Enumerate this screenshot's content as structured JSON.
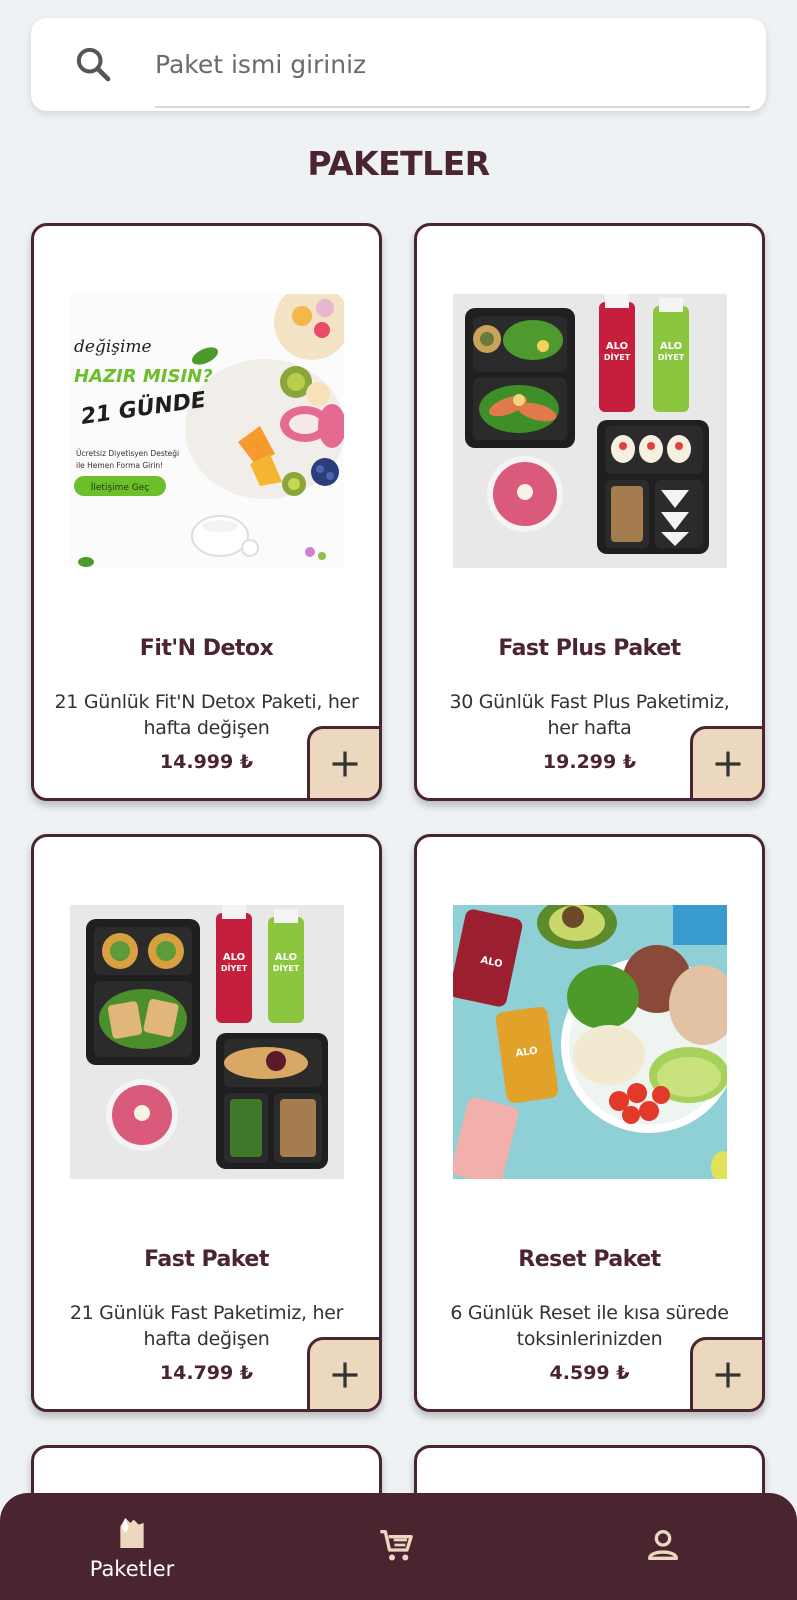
{
  "search": {
    "placeholder": "Paket ismi giriniz",
    "value": ""
  },
  "page_title": "PAKETLER",
  "cards": [
    {
      "name": "Fit'N Detox",
      "desc": "21 Günlük Fit'N Detox Paketi, her hafta değişen",
      "price": "14.999 ₺",
      "promo": {
        "line1": "değişime",
        "line2": "HAZIR MISIN?",
        "line3": "21 GÜNDE",
        "line4": "Ücretsiz Diyetisyen Desteği",
        "line5": "ile Hemen Forma Girin!",
        "cta": "İletişime Geç"
      }
    },
    {
      "name": "Fast Plus Paket",
      "desc": "30 Günlük Fast Plus Paketimiz, her hafta",
      "price": "19.299 ₺"
    },
    {
      "name": "Fast Paket",
      "desc": "21 Günlük Fast Paketimiz, her hafta değişen",
      "price": "14.799 ₺"
    },
    {
      "name": "Reset Paket",
      "desc": "6 Günlük Reset ile kısa sürede toksinlerinizden",
      "price": "4.599 ₺"
    }
  ],
  "bottom_nav": {
    "items": [
      {
        "label": "Paketler",
        "icon": "package-icon",
        "active": true
      },
      {
        "label": "",
        "icon": "cart-icon",
        "active": false
      },
      {
        "label": "",
        "icon": "profile-icon",
        "active": false
      }
    ]
  },
  "colors": {
    "brand": "#4a2530",
    "add_button": "#ecd7bf",
    "background": "#eef2f4"
  }
}
